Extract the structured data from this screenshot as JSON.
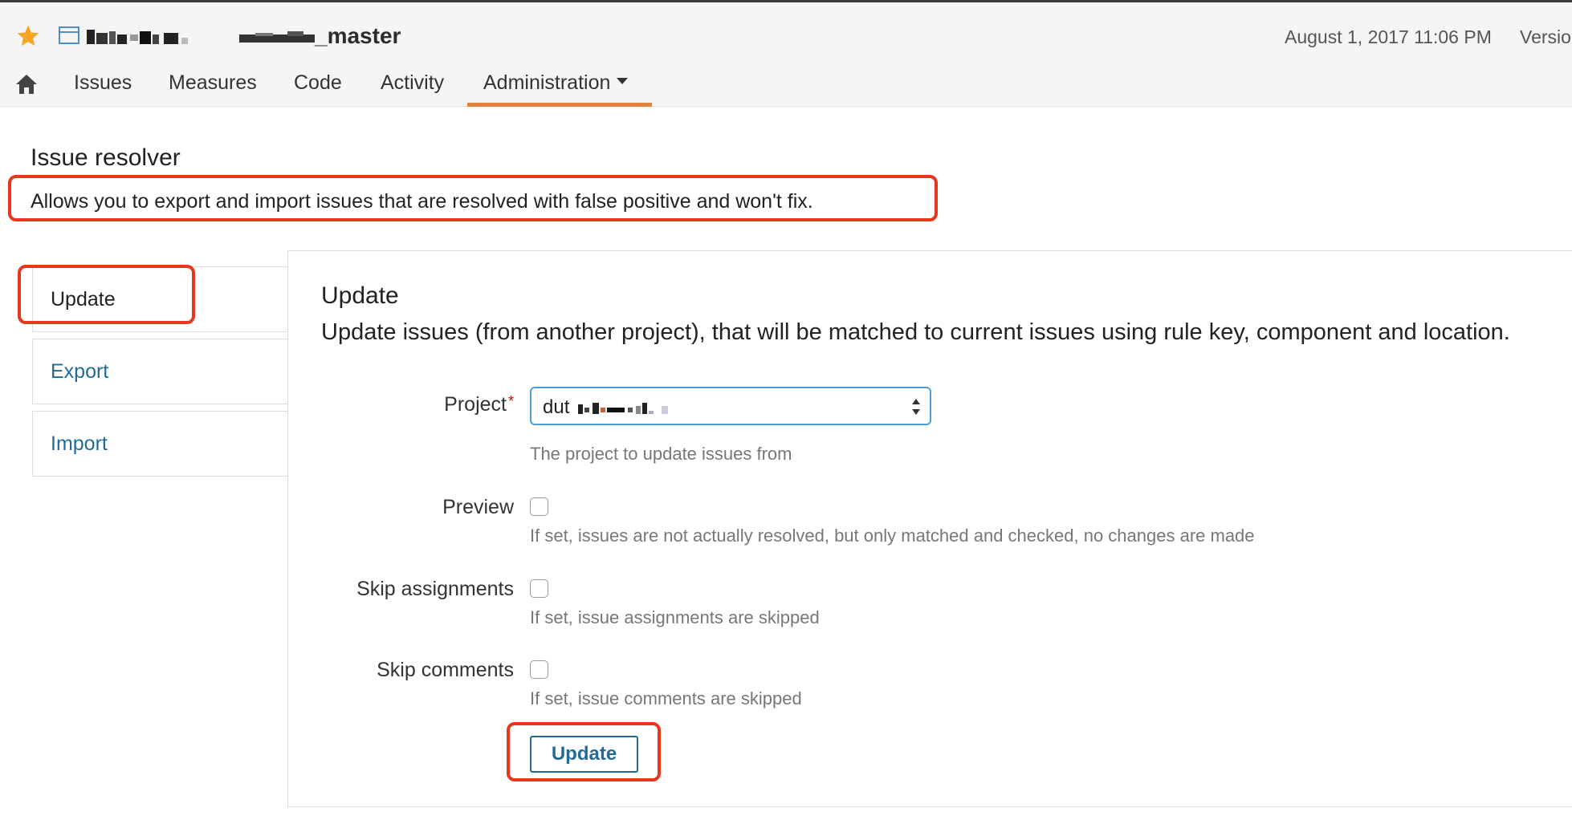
{
  "header": {
    "project_name": "_master",
    "date": "August 1, 2017 11:06 PM",
    "version": "Versio"
  },
  "nav": {
    "items": [
      {
        "label": "Issues"
      },
      {
        "label": "Measures"
      },
      {
        "label": "Code"
      },
      {
        "label": "Activity"
      },
      {
        "label": "Administration"
      }
    ],
    "active": "Administration"
  },
  "page": {
    "title": "Issue resolver",
    "description": "Allows you to export and import issues that are resolved with false positive and won't fix."
  },
  "tabs": [
    {
      "label": "Update"
    },
    {
      "label": "Export"
    },
    {
      "label": "Import"
    }
  ],
  "panel": {
    "title": "Update",
    "description": "Update issues (from another project), that will be matched to current issues using rule key, component and location.",
    "project": {
      "label": "Project",
      "required_mark": "*",
      "value": "dut",
      "help": "The project to update issues from"
    },
    "preview": {
      "label": "Preview",
      "checked": false,
      "help": "If set, issues are not actually resolved, but only matched and checked, no changes are made"
    },
    "skip_assignments": {
      "label": "Skip assignments",
      "checked": false,
      "help": "If set, issue assignments are skipped"
    },
    "skip_comments": {
      "label": "Skip comments",
      "checked": false,
      "help": "If set, issue comments are skipped"
    },
    "submit_label": "Update"
  },
  "colors": {
    "accent_orange": "#e2813a",
    "link_blue": "#236a97",
    "annotation_red": "#e8361d",
    "star_orange": "#f5a623"
  },
  "icons": {
    "favorite": "star-icon",
    "project": "project-window-icon",
    "home": "home-icon",
    "dropdown": "caret-down-icon",
    "select_arrows": "select-arrows-icon"
  }
}
